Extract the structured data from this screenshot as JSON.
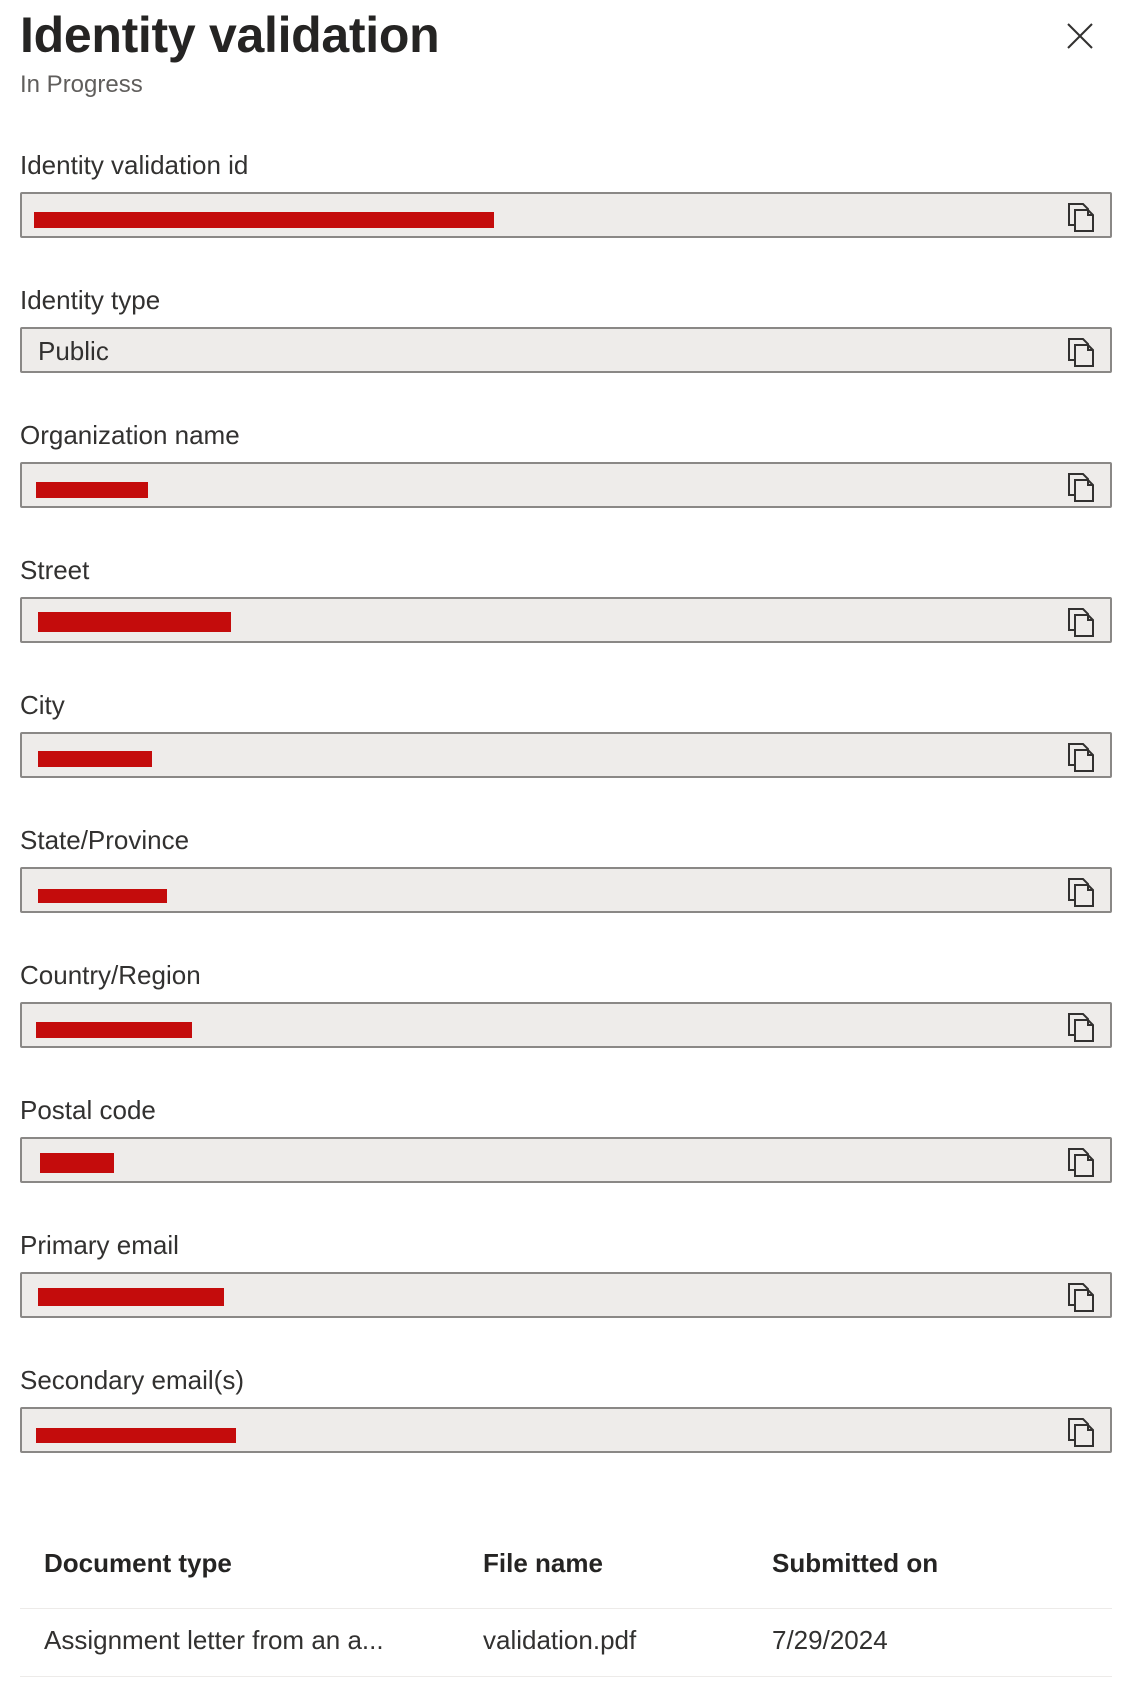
{
  "header": {
    "title": "Identity validation",
    "status": "In Progress",
    "close_icon": "close-icon"
  },
  "fields": [
    {
      "label": "Identity validation id",
      "value": "",
      "redacted": true
    },
    {
      "label": "Identity type",
      "value": "Public",
      "redacted": false
    },
    {
      "label": "Organization name",
      "value": "",
      "redacted": true
    },
    {
      "label": "Street",
      "value": "",
      "redacted": true
    },
    {
      "label": "City",
      "value": "",
      "redacted": true
    },
    {
      "label": "State/Province",
      "value": "",
      "redacted": true
    },
    {
      "label": "Country/Region",
      "value": "",
      "redacted": true
    },
    {
      "label": "Postal code",
      "value": "",
      "redacted": true
    },
    {
      "label": "Primary email",
      "value": "",
      "redacted": true
    },
    {
      "label": "Secondary email(s)",
      "value": "",
      "redacted": true
    }
  ],
  "documents": {
    "columns": [
      "Document type",
      "File name",
      "Submitted on"
    ],
    "rows": [
      [
        "Assignment letter from an a...",
        "validation.pdf",
        "7/29/2024"
      ]
    ]
  },
  "colors": {
    "redaction": "#c40c0c",
    "field_background": "#eeecea",
    "field_border": "#8a8886"
  }
}
